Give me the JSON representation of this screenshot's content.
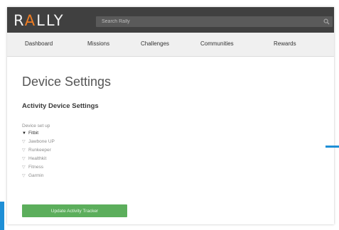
{
  "app": {
    "logo_text_1": "R",
    "logo_accent": "A",
    "logo_text_2": "LLY",
    "accent_color": "#ef7d22",
    "button_color": "#5cae5c",
    "highlight_color": "#1e8fd6"
  },
  "search": {
    "placeholder": "Search Rally"
  },
  "nav": {
    "items": [
      {
        "label": "Dashboard"
      },
      {
        "label": "Missions"
      },
      {
        "label": "Challenges"
      },
      {
        "label": "Communities"
      },
      {
        "label": "Rewards"
      }
    ]
  },
  "main": {
    "title": "Device Settings",
    "section_title": "Activity Device Settings",
    "list_label": "Device set up",
    "devices": [
      {
        "label": "Fitbit",
        "selected": true
      },
      {
        "label": "Jawbone UP",
        "selected": false
      },
      {
        "label": "Runkeeper",
        "selected": false
      },
      {
        "label": "Healthkit",
        "selected": false
      },
      {
        "label": "Fitness",
        "selected": false
      },
      {
        "label": "Garmin",
        "selected": false
      }
    ],
    "update_button_label": "Update Activity Tracker"
  }
}
